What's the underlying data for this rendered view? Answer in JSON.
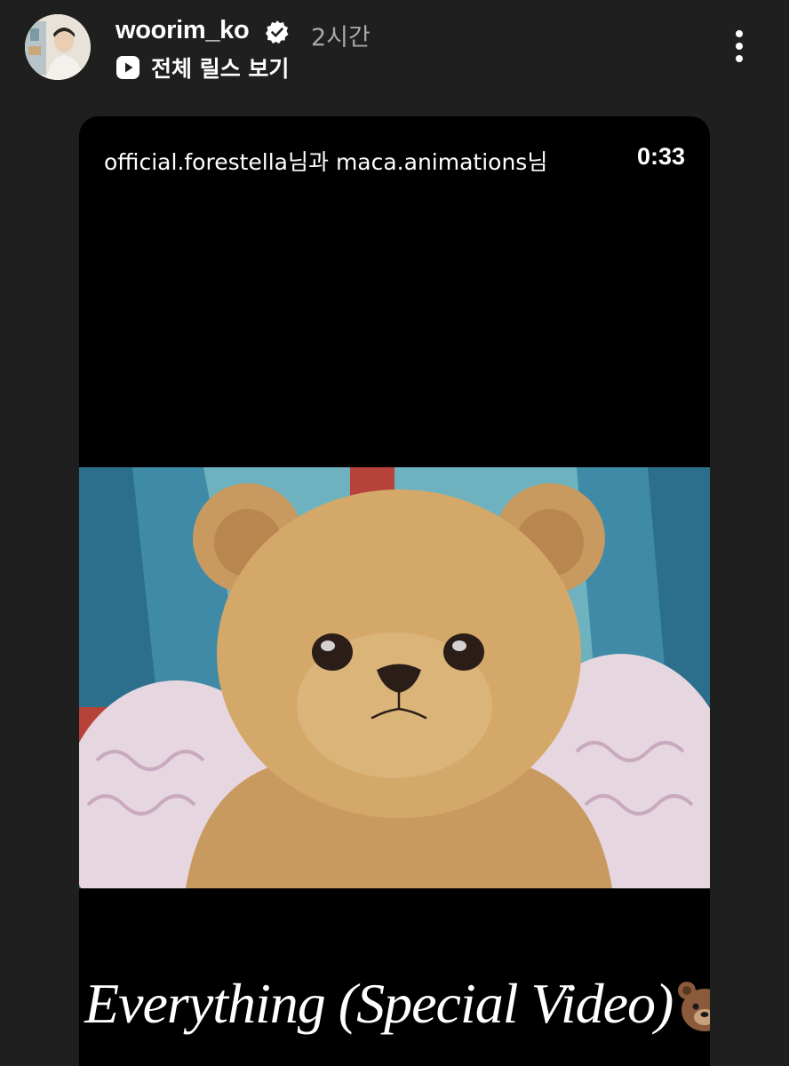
{
  "post": {
    "username": "woorim_ko",
    "verified_icon": "verified-badge-icon",
    "time_ago": "2시간",
    "reels_link_label": "전체 릴스 보기",
    "reels_icon": "play-square-icon",
    "more_icon": "more-vertical-icon"
  },
  "video": {
    "credits": "official.forestella님과 maca.animations님",
    "duration": "0:33",
    "caption": "Everything (Special Video)",
    "caption_emoji_icon": "bear-face-icon"
  },
  "colors": {
    "background": "#1f1f1f",
    "video_background": "#000000",
    "secondary_text": "#a8a8a8"
  }
}
